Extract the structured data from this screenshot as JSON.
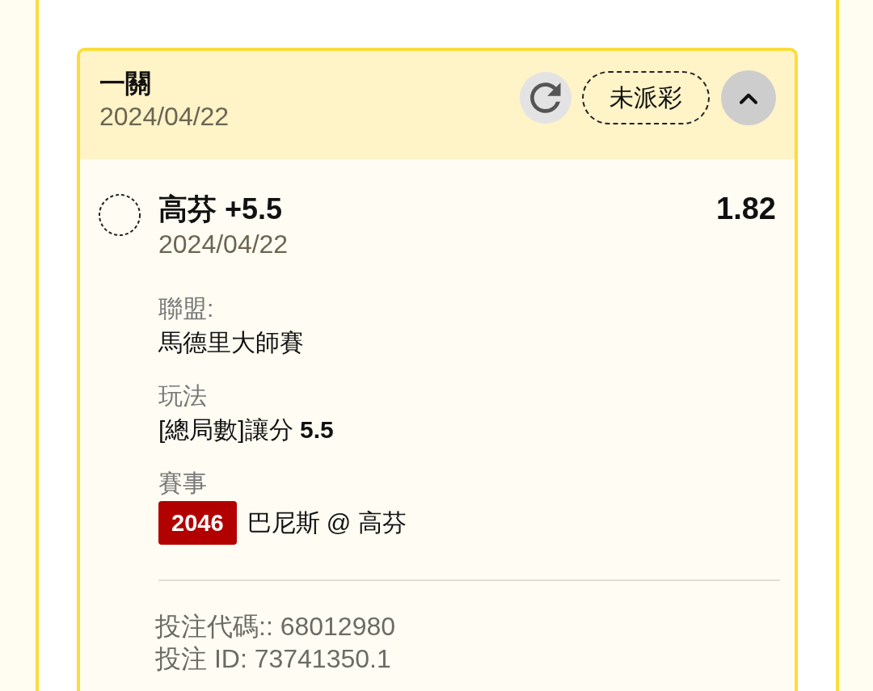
{
  "bet_card": {
    "title": "一關",
    "date": "2024/04/22",
    "status": "未派彩",
    "expanded": true,
    "selection": {
      "title": "高芬 +5.5",
      "odds": "1.82",
      "date": "2024/04/22"
    },
    "details": [
      {
        "label": "聯盟:",
        "value": "馬德里大師賽"
      },
      {
        "label": "玩法",
        "value": "[總局數]讓分 **5.5**"
      },
      {
        "label": "賽事",
        "badge": "2046",
        "value": "巴尼斯 @ 高芬"
      }
    ],
    "footer": [
      "投注代碼:: 68012980",
      "投注 ID: 73741350.1"
    ]
  }
}
